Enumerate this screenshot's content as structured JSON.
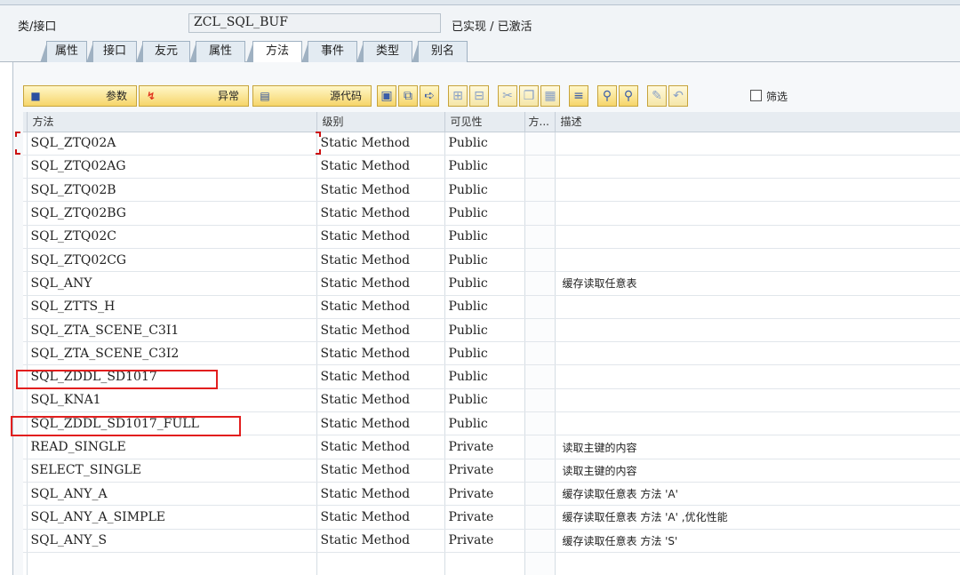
{
  "header": {
    "label": "类/接口",
    "class_name": "ZCL_SQL_BUF",
    "status": "已实现 / 已激活"
  },
  "tabs": [
    {
      "label": "属性"
    },
    {
      "label": "接口"
    },
    {
      "label": "友元"
    },
    {
      "label": "属性"
    },
    {
      "label": "方法"
    },
    {
      "label": "事件"
    },
    {
      "label": "类型"
    },
    {
      "label": "别名"
    }
  ],
  "toolbar": {
    "params_label": "参数",
    "exceptions_label": "异常",
    "source_label": "源代码",
    "filter_label": "筛选"
  },
  "columns": {
    "method": "方法",
    "level": "级别",
    "visibility": "可见性",
    "m": "方...",
    "description": "描述"
  },
  "rows": [
    {
      "method": "SQL_ZTQ02A",
      "level": "Static Method",
      "visibility": "Public",
      "description": ""
    },
    {
      "method": "SQL_ZTQ02AG",
      "level": "Static Method",
      "visibility": "Public",
      "description": ""
    },
    {
      "method": "SQL_ZTQ02B",
      "level": "Static Method",
      "visibility": "Public",
      "description": ""
    },
    {
      "method": "SQL_ZTQ02BG",
      "level": "Static Method",
      "visibility": "Public",
      "description": ""
    },
    {
      "method": "SQL_ZTQ02C",
      "level": "Static Method",
      "visibility": "Public",
      "description": ""
    },
    {
      "method": "SQL_ZTQ02CG",
      "level": "Static Method",
      "visibility": "Public",
      "description": ""
    },
    {
      "method": "SQL_ANY",
      "level": "Static Method",
      "visibility": "Public",
      "description": "缓存读取任意表"
    },
    {
      "method": "SQL_ZTTS_H",
      "level": "Static Method",
      "visibility": "Public",
      "description": ""
    },
    {
      "method": "SQL_ZTA_SCENE_C3I1",
      "level": "Static Method",
      "visibility": "Public",
      "description": ""
    },
    {
      "method": "SQL_ZTA_SCENE_C3I2",
      "level": "Static Method",
      "visibility": "Public",
      "description": ""
    },
    {
      "method": "SQL_ZDDL_SD1017",
      "level": "Static Method",
      "visibility": "Public",
      "description": ""
    },
    {
      "method": "SQL_KNA1",
      "level": "Static Method",
      "visibility": "Public",
      "description": ""
    },
    {
      "method": "SQL_ZDDL_SD1017_FULL",
      "level": "Static Method",
      "visibility": "Public",
      "description": ""
    },
    {
      "method": "READ_SINGLE",
      "level": "Static Method",
      "visibility": "Private",
      "description": "读取主键的内容"
    },
    {
      "method": "SELECT_SINGLE",
      "level": "Static Method",
      "visibility": "Private",
      "description": "读取主键的内容"
    },
    {
      "method": "SQL_ANY_A",
      "level": "Static Method",
      "visibility": "Private",
      "description": "缓存读取任意表 方法 'A'"
    },
    {
      "method": "SQL_ANY_A_SIMPLE",
      "level": "Static Method",
      "visibility": "Private",
      "description": "缓存读取任意表 方法 'A' ,优化性能"
    },
    {
      "method": "SQL_ANY_S",
      "level": "Static Method",
      "visibility": "Private",
      "description": "缓存读取任意表 方法 'S'"
    }
  ],
  "colors": {
    "highlight": "#e21e1e",
    "toolbar_button": "#f6d56a",
    "active_tab": "#ffffff"
  }
}
